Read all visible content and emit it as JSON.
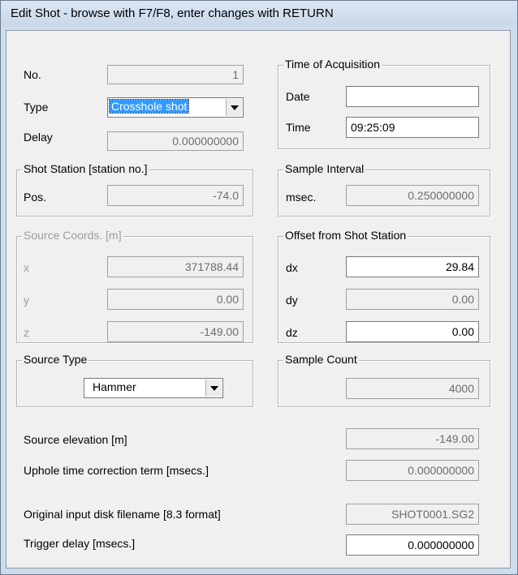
{
  "window": {
    "title": "Edit Shot - browse with F7/F8, enter changes with RETURN"
  },
  "general": {
    "no_label": "No.",
    "no_value": "1",
    "type_label": "Type",
    "type_value": "Crosshole shot",
    "delay_label": "Delay",
    "delay_value": "0.000000000"
  },
  "time_of_acquisition": {
    "title": "Time of Acquisition",
    "date_label": "Date",
    "date_value": "",
    "time_label": "Time",
    "time_value": "09:25:09"
  },
  "shot_station": {
    "title": "Shot Station [station no.]",
    "pos_label": "Pos.",
    "pos_value": "-74.0"
  },
  "sample_interval": {
    "title": "Sample Interval",
    "msec_label": "msec.",
    "msec_value": "0.250000000"
  },
  "source_coords": {
    "title": "Source Coords. [m]",
    "x_label": "x",
    "x_value": "371788.44",
    "y_label": "y",
    "y_value": "0.00",
    "z_label": "z",
    "z_value": "-149.00"
  },
  "offset": {
    "title": "Offset from Shot Station",
    "dx_label": "dx",
    "dx_value": "29.84",
    "dy_label": "dy",
    "dy_value": "0.00",
    "dz_label": "dz",
    "dz_value": "0.00"
  },
  "source_type": {
    "title": "Source Type",
    "value": "Hammer"
  },
  "sample_count": {
    "title": "Sample Count",
    "value": "4000"
  },
  "bottom": {
    "elevation_label": "Source elevation [m]",
    "elevation_value": "-149.00",
    "uphole_label": "Uphole time correction term [msecs.]",
    "uphole_value": "0.000000000",
    "filename_label": "Original input disk filename [8.3 format]",
    "filename_value": "SHOT0001.SG2",
    "trigger_label": "Trigger delay [msecs.]",
    "trigger_value": "0.000000000"
  }
}
